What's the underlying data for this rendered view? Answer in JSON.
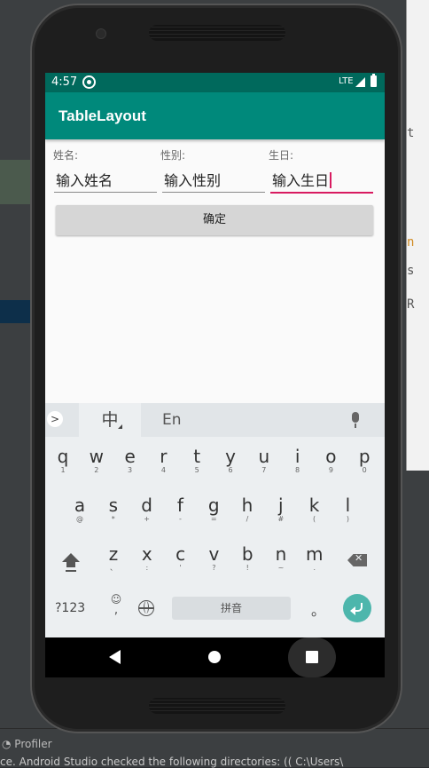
{
  "ide": {
    "right_panel_chars": [
      "t",
      "n",
      "s",
      "R"
    ],
    "profiler_label": "Profiler",
    "status_text": "ce. Android Studio checked the following directories: (( C:\\Users\\"
  },
  "device": {
    "status_bar": {
      "time": "4:57",
      "network": "LTE"
    },
    "app_bar": {
      "title": "TableLayout"
    },
    "form": {
      "name_label": "姓名:",
      "gender_label": "性别:",
      "birthday_label": "生日:",
      "name_input": "输入姓名",
      "gender_input": "输入性别",
      "birthday_input": "输入生日",
      "confirm_button": "确定"
    },
    "keyboard": {
      "arrow": ">",
      "lang_zh": "中",
      "lang_en": "En",
      "row1": [
        {
          "k": "q",
          "s": "1"
        },
        {
          "k": "w",
          "s": "2"
        },
        {
          "k": "e",
          "s": "3"
        },
        {
          "k": "r",
          "s": "4"
        },
        {
          "k": "t",
          "s": "5"
        },
        {
          "k": "y",
          "s": "6"
        },
        {
          "k": "u",
          "s": "7"
        },
        {
          "k": "i",
          "s": "8"
        },
        {
          "k": "o",
          "s": "9"
        },
        {
          "k": "p",
          "s": "0"
        }
      ],
      "row2": [
        {
          "k": "a",
          "s": "@"
        },
        {
          "k": "s",
          "s": "*"
        },
        {
          "k": "d",
          "s": "+"
        },
        {
          "k": "f",
          "s": "-"
        },
        {
          "k": "g",
          "s": "="
        },
        {
          "k": "h",
          "s": "/"
        },
        {
          "k": "j",
          "s": "#"
        },
        {
          "k": "k",
          "s": "("
        },
        {
          "k": "l",
          "s": ")"
        }
      ],
      "row3": [
        {
          "k": "z",
          "s": "、"
        },
        {
          "k": "x",
          "s": ":"
        },
        {
          "k": "c",
          "s": "'"
        },
        {
          "k": "v",
          "s": "?"
        },
        {
          "k": "b",
          "s": "!"
        },
        {
          "k": "n",
          "s": "~"
        },
        {
          "k": "m",
          "s": "."
        }
      ],
      "num_key": "?123",
      "emoji_key": "☺",
      "emoji_sub": ",",
      "space_label": "拼音",
      "period_key": "。"
    }
  }
}
